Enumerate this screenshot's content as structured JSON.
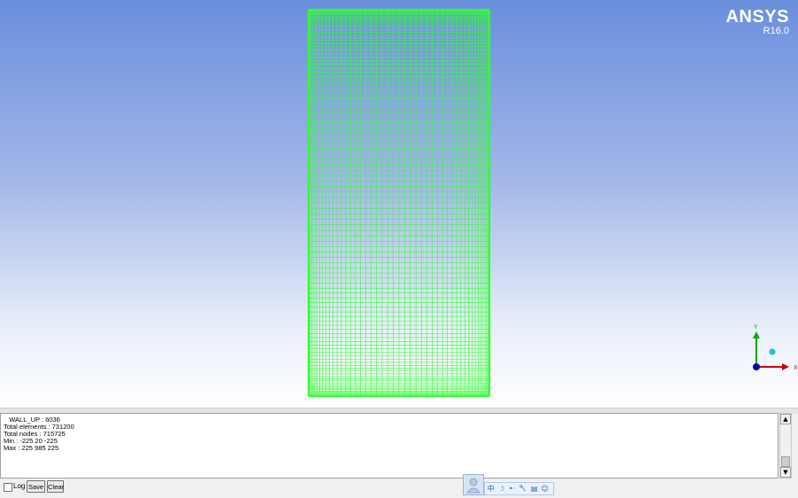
{
  "logo": {
    "brand": "ANSYS",
    "version": "R16.0"
  },
  "colors": {
    "mesh": "#33ff33",
    "axis_y": "#00aa00",
    "axis_x": "#cc0000",
    "axis_z": "#0000aa",
    "origin_dot": "#20c0d0",
    "ime_icon": "#1f62c9"
  },
  "triad": {
    "y_label": "Y",
    "x_label": "X"
  },
  "console": {
    "lines": [
      "   WALL_UP : 6036",
      "Total elements : 731200",
      "Total nodes : 715725",
      "Min : -225 20 -225",
      "Max : 225 985 225"
    ]
  },
  "scrollbar": {
    "up_icon": "triangle-up-icon",
    "down_icon": "triangle-down-icon"
  },
  "bottom": {
    "log_label": "Log",
    "save_label": "Save",
    "clear_label": "Clear"
  },
  "ime": {
    "icons": [
      {
        "name": "chinese-mode-icon",
        "glyph": "中"
      },
      {
        "name": "moon-icon",
        "glyph": "☽"
      },
      {
        "name": "punctuation-icon",
        "glyph": "•‧"
      },
      {
        "name": "wrench-icon",
        "glyph": "🔧"
      },
      {
        "name": "clipboard-icon",
        "glyph": "▤"
      },
      {
        "name": "smiley-icon",
        "glyph": "☺"
      }
    ]
  }
}
